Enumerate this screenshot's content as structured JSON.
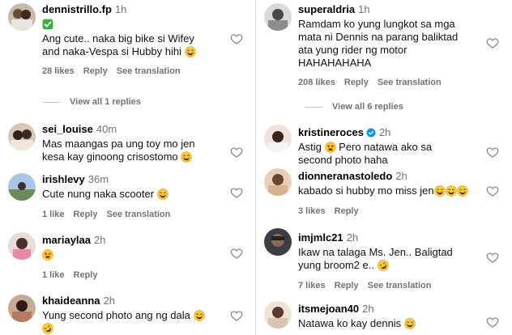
{
  "left": {
    "c1": {
      "user": "dennistrillo.fp",
      "time": "1h",
      "check": "✅",
      "text1": "Ang cute.. naka big bike si Wifey",
      "text2": "and naka-Vespa si Hubby hihi",
      "likes": "28 likes",
      "reply": "Reply",
      "see": "See translation",
      "view": "View all 1 replies"
    },
    "c2": {
      "user": "sei_louise",
      "time": "40m",
      "text1": "Mas maangas pa ung toy mo jen",
      "text2": "kesa kay ginoong crisostomo"
    },
    "c3": {
      "user": "irishlevy",
      "time": "36m",
      "text1": "Cute nung naka scooter",
      "likes": "1 like",
      "reply": "Reply",
      "see": "See translation"
    },
    "c4": {
      "user": "mariaylaa",
      "time": "2h",
      "likes": "1 like",
      "reply": "Reply"
    },
    "c5": {
      "user": "khaideanna",
      "time": "2h",
      "text1": "Yung second photo ang ng dala"
    }
  },
  "right": {
    "c1": {
      "user": "superaldria",
      "time": "1h",
      "text1": "Ramdam ko yung lungkot sa mga",
      "text2": "mata ni Dennis na parang baliktad",
      "text3": "ata yung rider ng motor",
      "text4": "HAHAHAHAHA",
      "likes": "208 likes",
      "reply": "Reply",
      "see": "See translation",
      "view": "View all 6 replies"
    },
    "c2": {
      "user": "kristineroces",
      "time": "2h",
      "text1a": "Astig",
      "text1b": "Pero natawa ako sa",
      "text2": "second photo haha"
    },
    "c3": {
      "user": "dionneranastoledo",
      "time": "2h",
      "text1": "kabado si hubby mo miss jen",
      "likes": "3 likes",
      "reply": "Reply"
    },
    "c4": {
      "user": "imjmlc21",
      "time": "2h",
      "text1": "Ikaw na talaga Ms. Jen.. Baligtad",
      "text2": "yung broom2 e..",
      "likes": "7 likes",
      "reply": "Reply",
      "see": "See translation"
    },
    "c5": {
      "user": "itsmejoan40",
      "time": "2h",
      "text1": "Natawa ko kay dennis"
    }
  },
  "colors": {
    "muted": "#737373",
    "heart": "#8e8e8e",
    "verified": "#0095f6"
  }
}
